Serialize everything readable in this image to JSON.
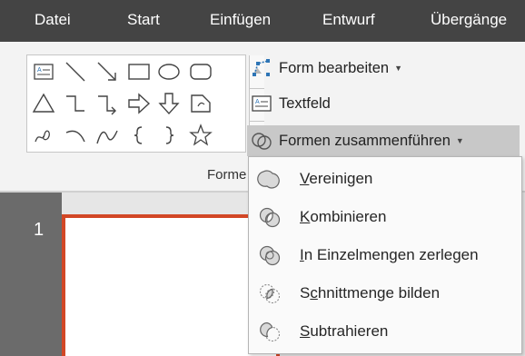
{
  "ribbon_tabs": [
    "Datei",
    "Start",
    "Einfügen",
    "Entwurf",
    "Übergänge"
  ],
  "commands": {
    "edit_shape": "Form bearbeiten",
    "textbox": "Textfeld",
    "merge_shapes": "Formen zusammenführen"
  },
  "group_label": "Forme",
  "slide_number": "1",
  "menu": {
    "items": [
      {
        "accel": "V",
        "rest": "ereinigen",
        "icon": "union-icon"
      },
      {
        "accel": "K",
        "rest": "ombinieren",
        "icon": "combine-icon"
      },
      {
        "accel": "I",
        "rest": "n Einzelmengen zerlegen",
        "icon": "fragment-icon"
      },
      {
        "pre": "S",
        "accel": "c",
        "rest": "hnittmenge bilden",
        "icon": "intersect-icon"
      },
      {
        "accel": "S",
        "rest": "ubtrahieren",
        "icon": "subtract-icon"
      }
    ]
  },
  "colors": {
    "tab_bar": "#444444",
    "ribbon": "#f3f3f3",
    "slide_border": "#d24726",
    "icon_blue": "#2e75b6"
  },
  "gallery_shapes": [
    "textbox-shape-icon",
    "line-shape-icon",
    "arrow-line-shape-icon",
    "rectangle-shape-icon",
    "oval-shape-icon",
    "rounded-rectangle-shape-icon",
    "triangle-shape-icon",
    "elbow-connector-shape-icon",
    "elbow-arrow-connector-shape-icon",
    "right-arrow-shape-icon",
    "down-arrow-shape-icon",
    "snip-rectangle-shape-icon",
    "freeform-shape-icon",
    "arc-shape-icon",
    "curve-shape-icon",
    "left-brace-shape-icon",
    "right-brace-shape-icon",
    "star-shape-icon"
  ]
}
